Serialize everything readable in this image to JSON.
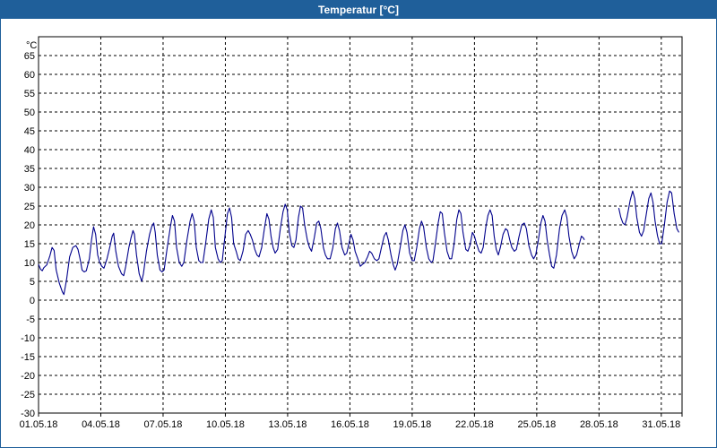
{
  "window": {
    "title": "Temperatur [°C]"
  },
  "chart_data": {
    "type": "line",
    "title": "Temperatur [°C]",
    "ylabel": "°C",
    "ylim": [
      -30,
      70
    ],
    "y_ticks": [
      "65",
      "60",
      "55",
      "50",
      "45",
      "40",
      "35",
      "30",
      "25",
      "20",
      "15",
      "10",
      "5",
      "0",
      "-5",
      "-10",
      "-15",
      "-20",
      "-25",
      "-30"
    ],
    "x_ticks": [
      "01.05.18",
      "04.05.18",
      "07.05.18",
      "10.05.18",
      "13.05.18",
      "16.05.18",
      "19.05.18",
      "22.05.18",
      "25.05.18",
      "28.05.18",
      "31.05.18"
    ],
    "x_start": "01.05.18",
    "x_end": "01.06.18",
    "grid": true,
    "line_color": "#00008b",
    "series": [
      {
        "gap_after_day": 26.3,
        "values": [
          [
            0.0,
            9.5
          ],
          [
            0.1,
            8.2
          ],
          [
            0.18,
            7.8
          ],
          [
            0.25,
            8.6
          ],
          [
            0.4,
            9.4
          ],
          [
            0.55,
            11.8
          ],
          [
            0.65,
            14.0
          ],
          [
            0.75,
            13.2
          ],
          [
            0.85,
            8.0
          ],
          [
            1.0,
            4.5
          ],
          [
            1.15,
            2.2
          ],
          [
            1.22,
            1.5
          ],
          [
            1.35,
            5.5
          ],
          [
            1.5,
            11.5
          ],
          [
            1.65,
            14.0
          ],
          [
            1.8,
            14.5
          ],
          [
            1.9,
            13.5
          ],
          [
            2.0,
            11.0
          ],
          [
            2.1,
            8.0
          ],
          [
            2.2,
            7.5
          ],
          [
            2.3,
            7.8
          ],
          [
            2.45,
            11.0
          ],
          [
            2.55,
            16.0
          ],
          [
            2.65,
            19.5
          ],
          [
            2.75,
            17.5
          ],
          [
            2.85,
            12.0
          ],
          [
            2.95,
            10.0
          ],
          [
            3.05,
            9.0
          ],
          [
            3.15,
            8.5
          ],
          [
            3.3,
            11.0
          ],
          [
            3.45,
            14.5
          ],
          [
            3.55,
            17.0
          ],
          [
            3.62,
            17.8
          ],
          [
            3.72,
            13.0
          ],
          [
            3.85,
            9.0
          ],
          [
            4.0,
            7.0
          ],
          [
            4.1,
            6.5
          ],
          [
            4.2,
            9.0
          ],
          [
            4.35,
            14.0
          ],
          [
            4.45,
            16.5
          ],
          [
            4.55,
            18.5
          ],
          [
            4.62,
            17.5
          ],
          [
            4.72,
            12.0
          ],
          [
            4.85,
            7.0
          ],
          [
            4.97,
            5.0
          ],
          [
            5.05,
            7.0
          ],
          [
            5.2,
            13.0
          ],
          [
            5.35,
            17.5
          ],
          [
            5.45,
            19.5
          ],
          [
            5.55,
            20.5
          ],
          [
            5.62,
            18.0
          ],
          [
            5.72,
            12.0
          ],
          [
            5.85,
            8.0
          ],
          [
            5.95,
            7.5
          ],
          [
            6.05,
            8.0
          ],
          [
            6.2,
            14.0
          ],
          [
            6.35,
            19.5
          ],
          [
            6.45,
            22.5
          ],
          [
            6.55,
            21.0
          ],
          [
            6.65,
            14.0
          ],
          [
            6.78,
            10.0
          ],
          [
            6.9,
            9.0
          ],
          [
            7.0,
            10.0
          ],
          [
            7.15,
            16.0
          ],
          [
            7.3,
            21.0
          ],
          [
            7.4,
            23.0
          ],
          [
            7.5,
            21.0
          ],
          [
            7.6,
            14.0
          ],
          [
            7.72,
            10.5
          ],
          [
            7.82,
            10.0
          ],
          [
            7.92,
            10.0
          ],
          [
            8.05,
            15.0
          ],
          [
            8.2,
            21.5
          ],
          [
            8.32,
            24.0
          ],
          [
            8.42,
            22.0
          ],
          [
            8.52,
            14.0
          ],
          [
            8.65,
            11.0
          ],
          [
            8.75,
            10.0
          ],
          [
            8.85,
            10.5
          ],
          [
            8.98,
            17.0
          ],
          [
            9.1,
            23.0
          ],
          [
            9.2,
            24.5
          ],
          [
            9.3,
            22.0
          ],
          [
            9.4,
            15.0
          ],
          [
            9.52,
            13.0
          ],
          [
            9.62,
            11.0
          ],
          [
            9.72,
            10.5
          ],
          [
            9.85,
            13.0
          ],
          [
            9.98,
            17.5
          ],
          [
            10.1,
            18.5
          ],
          [
            10.2,
            17.5
          ],
          [
            10.3,
            16.0
          ],
          [
            10.42,
            13.5
          ],
          [
            10.52,
            12.0
          ],
          [
            10.62,
            11.5
          ],
          [
            10.75,
            14.0
          ],
          [
            10.88,
            19.0
          ],
          [
            11.0,
            23.0
          ],
          [
            11.1,
            21.5
          ],
          [
            11.2,
            17.0
          ],
          [
            11.3,
            14.0
          ],
          [
            11.4,
            12.5
          ],
          [
            11.52,
            13.5
          ],
          [
            11.65,
            19.0
          ],
          [
            11.78,
            23.5
          ],
          [
            11.88,
            25.5
          ],
          [
            11.98,
            24.0
          ],
          [
            12.08,
            18.0
          ],
          [
            12.2,
            14.5
          ],
          [
            12.3,
            14.0
          ],
          [
            12.4,
            16.0
          ],
          [
            12.52,
            22.0
          ],
          [
            12.62,
            25.0
          ],
          [
            12.72,
            24.5
          ],
          [
            12.82,
            20.0
          ],
          [
            12.95,
            16.0
          ],
          [
            13.05,
            14.0
          ],
          [
            13.15,
            13.0
          ],
          [
            13.28,
            16.5
          ],
          [
            13.4,
            20.5
          ],
          [
            13.5,
            21.0
          ],
          [
            13.6,
            19.0
          ],
          [
            13.72,
            14.0
          ],
          [
            13.82,
            12.0
          ],
          [
            13.92,
            11.0
          ],
          [
            14.05,
            11.0
          ],
          [
            14.18,
            14.0
          ],
          [
            14.3,
            19.0
          ],
          [
            14.4,
            20.5
          ],
          [
            14.5,
            18.5
          ],
          [
            14.62,
            14.0
          ],
          [
            14.75,
            12.0
          ],
          [
            14.85,
            12.5
          ],
          [
            14.95,
            15.0
          ],
          [
            15.05,
            17.5
          ],
          [
            15.15,
            16.0
          ],
          [
            15.25,
            13.0
          ],
          [
            15.38,
            11.0
          ],
          [
            15.5,
            9.0
          ],
          [
            15.6,
            9.5
          ],
          [
            15.72,
            10.0
          ],
          [
            15.85,
            11.5
          ],
          [
            15.95,
            13.0
          ],
          [
            16.05,
            12.5
          ],
          [
            16.18,
            11.0
          ],
          [
            16.3,
            10.5
          ],
          [
            16.4,
            11.0
          ],
          [
            16.52,
            14.0
          ],
          [
            16.65,
            17.0
          ],
          [
            16.75,
            18.0
          ],
          [
            16.85,
            16.0
          ],
          [
            16.98,
            12.0
          ],
          [
            17.08,
            9.5
          ],
          [
            17.18,
            8.0
          ],
          [
            17.28,
            9.5
          ],
          [
            17.42,
            14.0
          ],
          [
            17.55,
            18.5
          ],
          [
            17.65,
            20.0
          ],
          [
            17.75,
            18.0
          ],
          [
            17.88,
            12.5
          ],
          [
            18.0,
            10.5
          ],
          [
            18.1,
            10.5
          ],
          [
            18.22,
            14.0
          ],
          [
            18.35,
            19.0
          ],
          [
            18.45,
            21.0
          ],
          [
            18.55,
            19.5
          ],
          [
            18.68,
            14.0
          ],
          [
            18.8,
            11.0
          ],
          [
            18.92,
            10.0
          ],
          [
            19.0,
            10.5
          ],
          [
            19.12,
            15.0
          ],
          [
            19.25,
            20.5
          ],
          [
            19.35,
            23.5
          ],
          [
            19.45,
            23.0
          ],
          [
            19.55,
            18.0
          ],
          [
            19.68,
            13.0
          ],
          [
            19.8,
            11.0
          ],
          [
            19.9,
            11.0
          ],
          [
            20.02,
            15.0
          ],
          [
            20.15,
            21.5
          ],
          [
            20.25,
            24.0
          ],
          [
            20.35,
            23.0
          ],
          [
            20.45,
            18.0
          ],
          [
            20.58,
            13.5
          ],
          [
            20.68,
            13.0
          ],
          [
            20.78,
            14.5
          ],
          [
            20.9,
            18.0
          ],
          [
            21.0,
            17.0
          ],
          [
            21.1,
            15.0
          ],
          [
            21.22,
            13.0
          ],
          [
            21.32,
            12.5
          ],
          [
            21.42,
            14.0
          ],
          [
            21.55,
            19.5
          ],
          [
            21.65,
            22.5
          ],
          [
            21.75,
            24.0
          ],
          [
            21.85,
            22.5
          ],
          [
            21.95,
            17.0
          ],
          [
            22.05,
            13.5
          ],
          [
            22.15,
            12.0
          ],
          [
            22.25,
            14.0
          ],
          [
            22.38,
            17.5
          ],
          [
            22.5,
            19.0
          ],
          [
            22.6,
            18.5
          ],
          [
            22.7,
            16.0
          ],
          [
            22.8,
            14.0
          ],
          [
            22.92,
            13.0
          ],
          [
            23.02,
            13.5
          ],
          [
            23.15,
            17.0
          ],
          [
            23.28,
            20.0
          ],
          [
            23.4,
            20.5
          ],
          [
            23.5,
            19.0
          ],
          [
            23.62,
            14.5
          ],
          [
            23.75,
            12.0
          ],
          [
            23.85,
            11.0
          ],
          [
            23.95,
            12.0
          ],
          [
            24.08,
            16.0
          ],
          [
            24.2,
            20.5
          ],
          [
            24.3,
            22.5
          ],
          [
            24.4,
            21.0
          ],
          [
            24.5,
            16.0
          ],
          [
            24.62,
            12.0
          ],
          [
            24.72,
            9.0
          ],
          [
            24.82,
            8.5
          ],
          [
            24.95,
            12.0
          ],
          [
            25.1,
            19.0
          ],
          [
            25.22,
            22.5
          ],
          [
            25.35,
            24.0
          ],
          [
            25.45,
            22.0
          ],
          [
            25.55,
            17.0
          ],
          [
            25.68,
            13.0
          ],
          [
            25.8,
            11.0
          ],
          [
            25.92,
            12.0
          ],
          [
            26.05,
            15.0
          ],
          [
            26.15,
            17.0
          ],
          [
            26.25,
            16.5
          ],
          [
            26.3,
            16.0
          ],
          null,
          [
            27.95,
            24.5
          ],
          [
            28.05,
            22.0
          ],
          [
            28.15,
            20.5
          ],
          [
            28.25,
            20.0
          ],
          [
            28.35,
            22.0
          ],
          [
            28.5,
            26.5
          ],
          [
            28.62,
            29.0
          ],
          [
            28.72,
            27.0
          ],
          [
            28.82,
            22.0
          ],
          [
            28.95,
            18.0
          ],
          [
            29.05,
            17.0
          ],
          [
            29.15,
            18.5
          ],
          [
            29.28,
            23.0
          ],
          [
            29.4,
            27.0
          ],
          [
            29.5,
            28.5
          ],
          [
            29.6,
            26.0
          ],
          [
            29.7,
            21.0
          ],
          [
            29.82,
            17.0
          ],
          [
            29.92,
            15.0
          ],
          [
            30.02,
            15.0
          ],
          [
            30.15,
            20.0
          ],
          [
            30.28,
            26.0
          ],
          [
            30.4,
            29.0
          ],
          [
            30.5,
            28.5
          ],
          [
            30.62,
            23.0
          ],
          [
            30.75,
            19.0
          ],
          [
            30.85,
            18.0
          ]
        ]
      }
    ]
  }
}
